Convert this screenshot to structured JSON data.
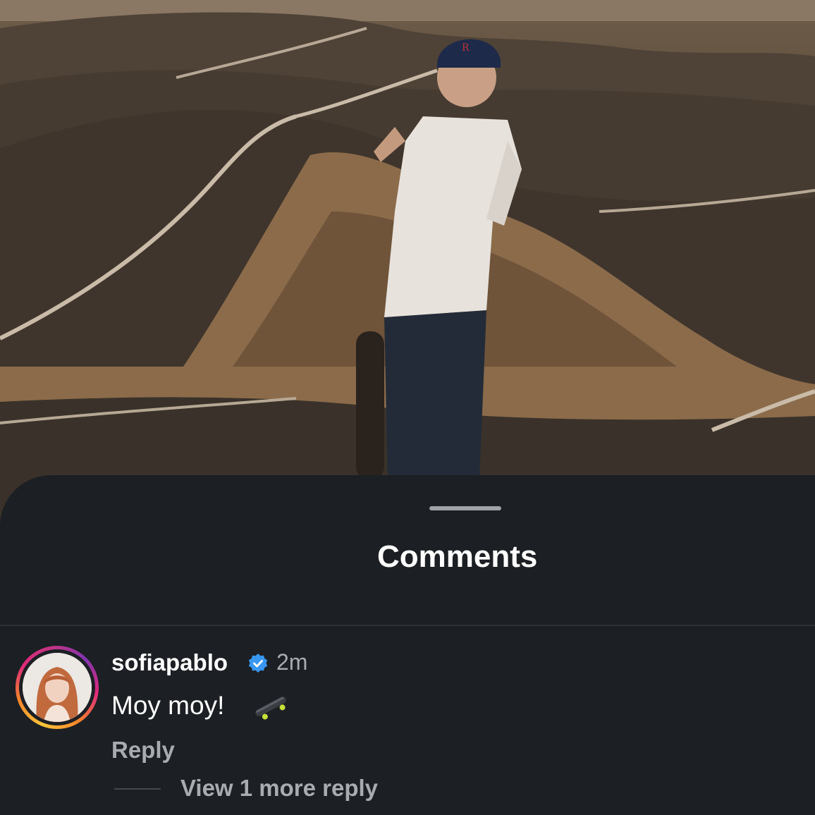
{
  "sheet": {
    "title": "Comments"
  },
  "comment": {
    "username": "sofiapablo",
    "verified": true,
    "time": "2m",
    "text": "Moy moy!",
    "emoji_icon": "skateboard-icon",
    "reply_label": "Reply",
    "view_replies_label": "View 1 more reply"
  },
  "colors": {
    "sheet_bg": "#1c1f23",
    "primary_text": "#ffffff",
    "secondary_text": "#a8acb1",
    "verified_blue": "#3897f0"
  }
}
